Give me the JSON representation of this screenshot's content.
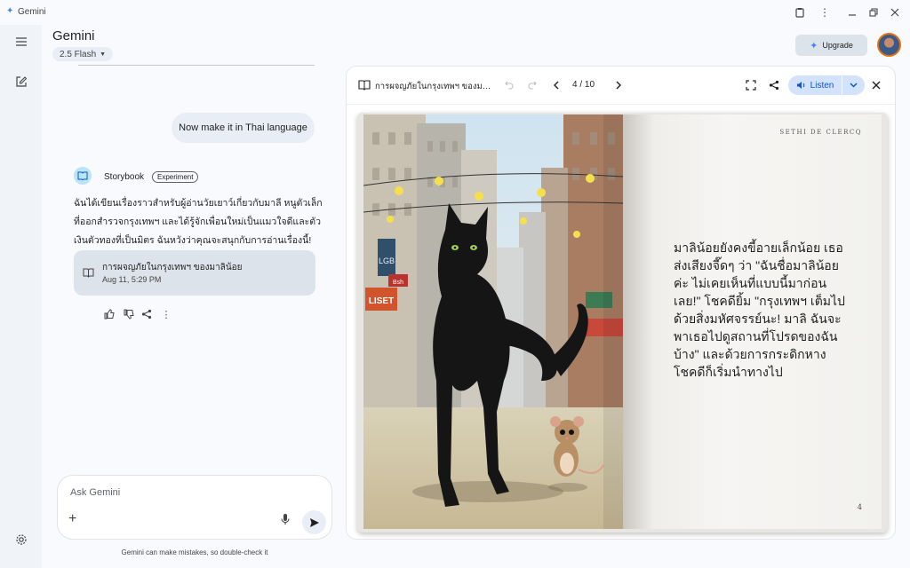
{
  "window": {
    "app_name": "Gemini"
  },
  "header": {
    "brand": "Gemini",
    "model": "2.5 Flash",
    "upgrade_label": "Upgrade"
  },
  "chat": {
    "user_message": "Now make it in Thai language",
    "assistant": {
      "name": "Storybook",
      "badge": "Experiment",
      "text": "ฉันได้เขียนเรื่องราวสำหรับผู้อ่านวัยเยาว์เกี่ยวกับมาลี หนูตัวเล็กที่ออกสำรวจกรุงเทพฯ และได้รู้จักเพื่อนใหม่เป็นแมวใจดีและตัวเงินตัวทองที่เป็นมิตร ฉันหวังว่าคุณจะสนุกกับการอ่านเรื่องนี้!",
      "card": {
        "title": "การผจญภัยในกรุงเทพฯ ของมาลิน้อย",
        "date": "Aug 11, 5:29 PM"
      }
    }
  },
  "input": {
    "placeholder": "Ask Gemini",
    "disclaimer": "Gemini can make mistakes, so double-check it"
  },
  "viewer": {
    "title": "การผจญภัยในกรุงเทพฯ ของมาลิ...",
    "page_indicator": "4 / 10",
    "listen_label": "Listen",
    "book": {
      "author": "SETHI DE CLERCQ",
      "text": "มาลิน้อยยังคงขี้อายเล็กน้อย เธอส่งเสียงจี๊ดๆ ว่า \"ฉันชื่อมาลิน้อยค่ะ ไม่เคยเห็นที่แบบนี้มาก่อนเลย!\" โชคดียิ้ม \"กรุงเทพฯ เต็มไปด้วยสิ่งมหัศจรรย์นะ! มาลิ ฉันจะพาเธอไปดูสถานที่โปรดของฉันบ้าง\" และด้วยการกระดิกหาง โชคดีก็เริ่มนำทางไป",
      "page_number": "4",
      "sign_lgb": "LGB",
      "sign_liset": "LISET",
      "sign_bsh": "Bsh"
    }
  },
  "colors": {
    "accent": "#0b57d0",
    "listen_bg": "#d3e3fd"
  }
}
